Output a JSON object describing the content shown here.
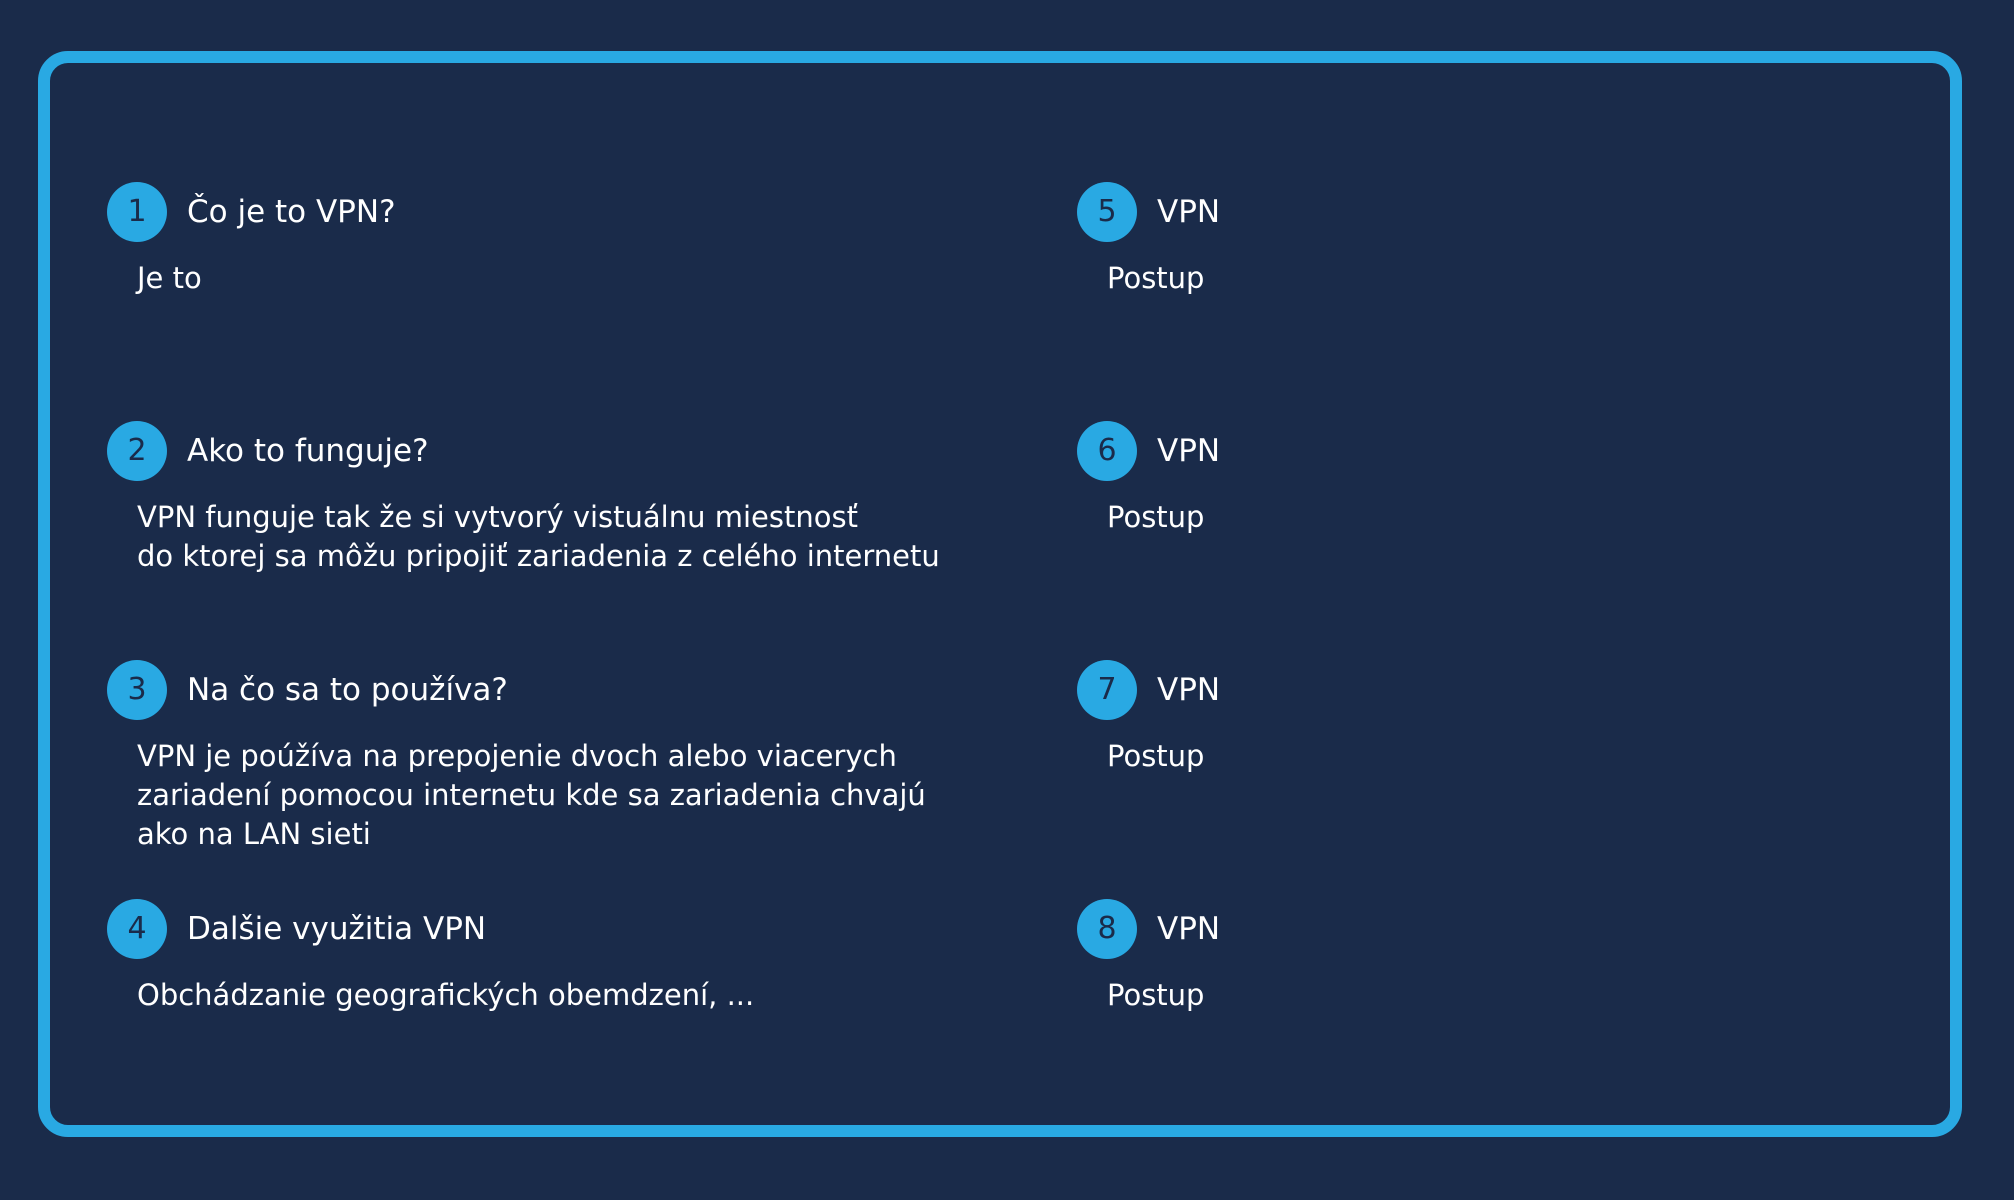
{
  "items": [
    {
      "number": "1",
      "title": "Čo je to VPN?",
      "body_lines": [
        "Je to"
      ]
    },
    {
      "number": "2",
      "title": "Ako to funguje?",
      "body_lines": [
        "VPN funguje tak že si vytvorý vistuálnu miestnosť",
        "do ktorej sa môžu pripojiť zariadenia z celého internetu"
      ]
    },
    {
      "number": "3",
      "title": "Na čo sa to používa?",
      "body_lines": [
        "VPN je poúžíva na prepojenie dvoch alebo viacerych",
        "zariadení pomocou internetu kde sa zariadenia chvajú",
        "ako na LAN sieti"
      ]
    },
    {
      "number": "4",
      "title": "Dalšie využitia VPN",
      "body_lines": [
        "Obchádzanie geografických obemdzení, ..."
      ]
    },
    {
      "number": "5",
      "title": "VPN",
      "body_lines": [
        "Postup"
      ]
    },
    {
      "number": "6",
      "title": "VPN",
      "body_lines": [
        "Postup"
      ]
    },
    {
      "number": "7",
      "title": "VPN",
      "body_lines": [
        "Postup"
      ]
    },
    {
      "number": "8",
      "title": "VPN",
      "body_lines": [
        "Postup"
      ]
    }
  ],
  "colors": {
    "background": "#1a2b4a",
    "accent": "#29a9e3",
    "text": "#ffffff"
  }
}
